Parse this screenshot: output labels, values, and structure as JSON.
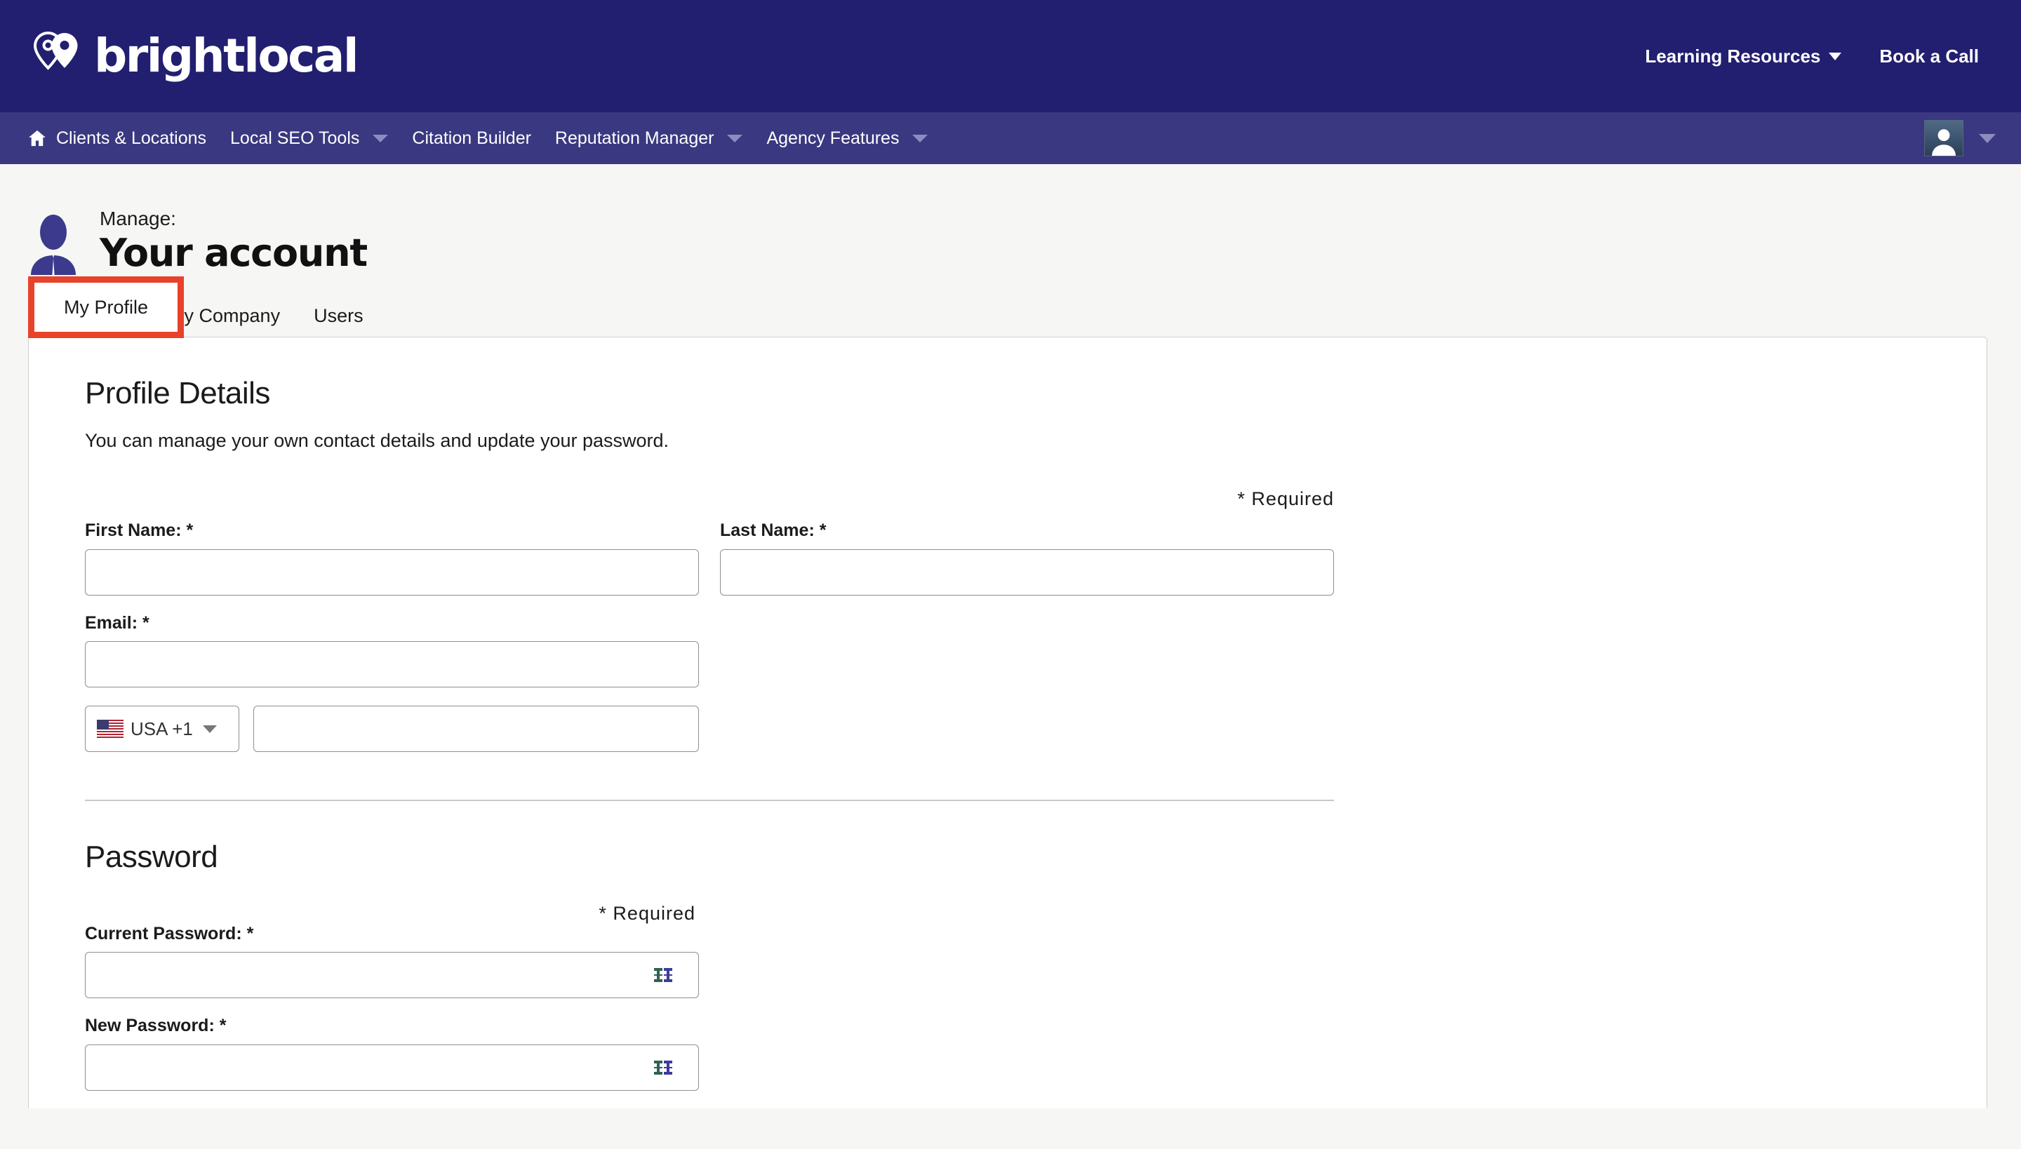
{
  "brand": {
    "name": "brightlocal",
    "logo_icon": "location-pin-icon",
    "header_bg": "#221f70",
    "nav_bg": "#3a3880",
    "highlight_color": "#e8422a"
  },
  "topbar": {
    "links": [
      {
        "label": "Learning Resources",
        "has_caret": true
      },
      {
        "label": "Book a Call",
        "has_caret": false
      }
    ]
  },
  "nav": {
    "items": [
      {
        "label": "Clients & Locations",
        "icon": "home-icon",
        "has_caret": false
      },
      {
        "label": "Local SEO Tools",
        "icon": "",
        "has_caret": true
      },
      {
        "label": "Citation Builder",
        "icon": "",
        "has_caret": false
      },
      {
        "label": "Reputation Manager",
        "icon": "",
        "has_caret": true
      },
      {
        "label": "Agency Features",
        "icon": "",
        "has_caret": true
      }
    ],
    "account_menu": {
      "avatar_icon": "user-avatar-icon",
      "caret": true
    }
  },
  "page": {
    "eyebrow": "Manage:",
    "title": "Your account",
    "icon": "user-profile-icon"
  },
  "tabs": {
    "items": [
      {
        "label": "My Profile",
        "active": true
      },
      {
        "label": "My Company",
        "active": false
      },
      {
        "label": "Users",
        "active": false
      }
    ],
    "highlighted": "My Profile"
  },
  "profile_details": {
    "title": "Profile Details",
    "subtitle": "You can manage your own contact details and update your password.",
    "required_note": "*  Required",
    "fields": {
      "first_name": {
        "label": "First Name: *",
        "value": "",
        "placeholder": ""
      },
      "last_name": {
        "label": "Last Name: *",
        "value": "",
        "placeholder": ""
      },
      "email": {
        "label": "Email: *",
        "value": "",
        "placeholder": ""
      },
      "phone": {
        "value": "",
        "placeholder": ""
      }
    },
    "country": {
      "label": "USA +1",
      "flag": "us-flag-icon"
    }
  },
  "password": {
    "title": "Password",
    "required_note": "*  Required",
    "fields": {
      "current_password": {
        "label": "Current Password: *",
        "value": "",
        "placeholder": ""
      },
      "new_password": {
        "label": "New Password: *",
        "value": "",
        "placeholder": ""
      }
    },
    "field_icon": "password-manager-icon"
  }
}
